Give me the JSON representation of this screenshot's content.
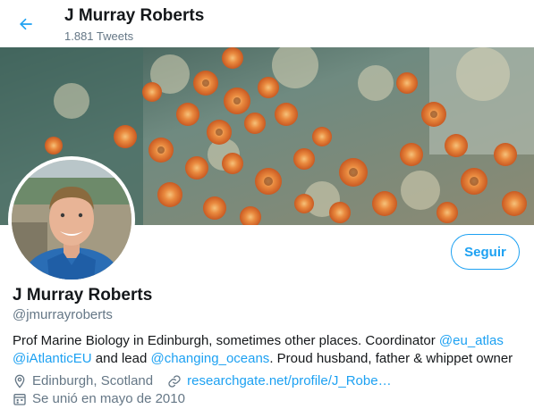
{
  "header": {
    "name": "J Murray Roberts",
    "tweet_count": "1.881 Tweets"
  },
  "profile": {
    "name": "J Murray Roberts",
    "handle": "@jmurrayroberts",
    "follow_label": "Seguir"
  },
  "bio": {
    "line1_text": "Prof Marine Biology in Edinburgh, sometimes other places. Coordinator ",
    "line1_mention": "@eu_atlas",
    "line2_mention1": "@iAtlanticEU",
    "line2_text1": " and lead ",
    "line2_mention2": "@changing_oceans",
    "line2_text2": ". Proud husband, father & whippet owner"
  },
  "meta": {
    "location": "Edinburgh, Scotland",
    "website": "researchgate.net/profile/J_Robe…",
    "joined": "Se unió en mayo de 2010"
  },
  "icons": {
    "back": "arrow-left-icon",
    "location": "location-pin-icon",
    "website": "link-icon",
    "joined": "calendar-icon"
  },
  "colors": {
    "accent": "#1da1f2",
    "secondary_text": "#657786",
    "primary_text": "#14171a"
  }
}
